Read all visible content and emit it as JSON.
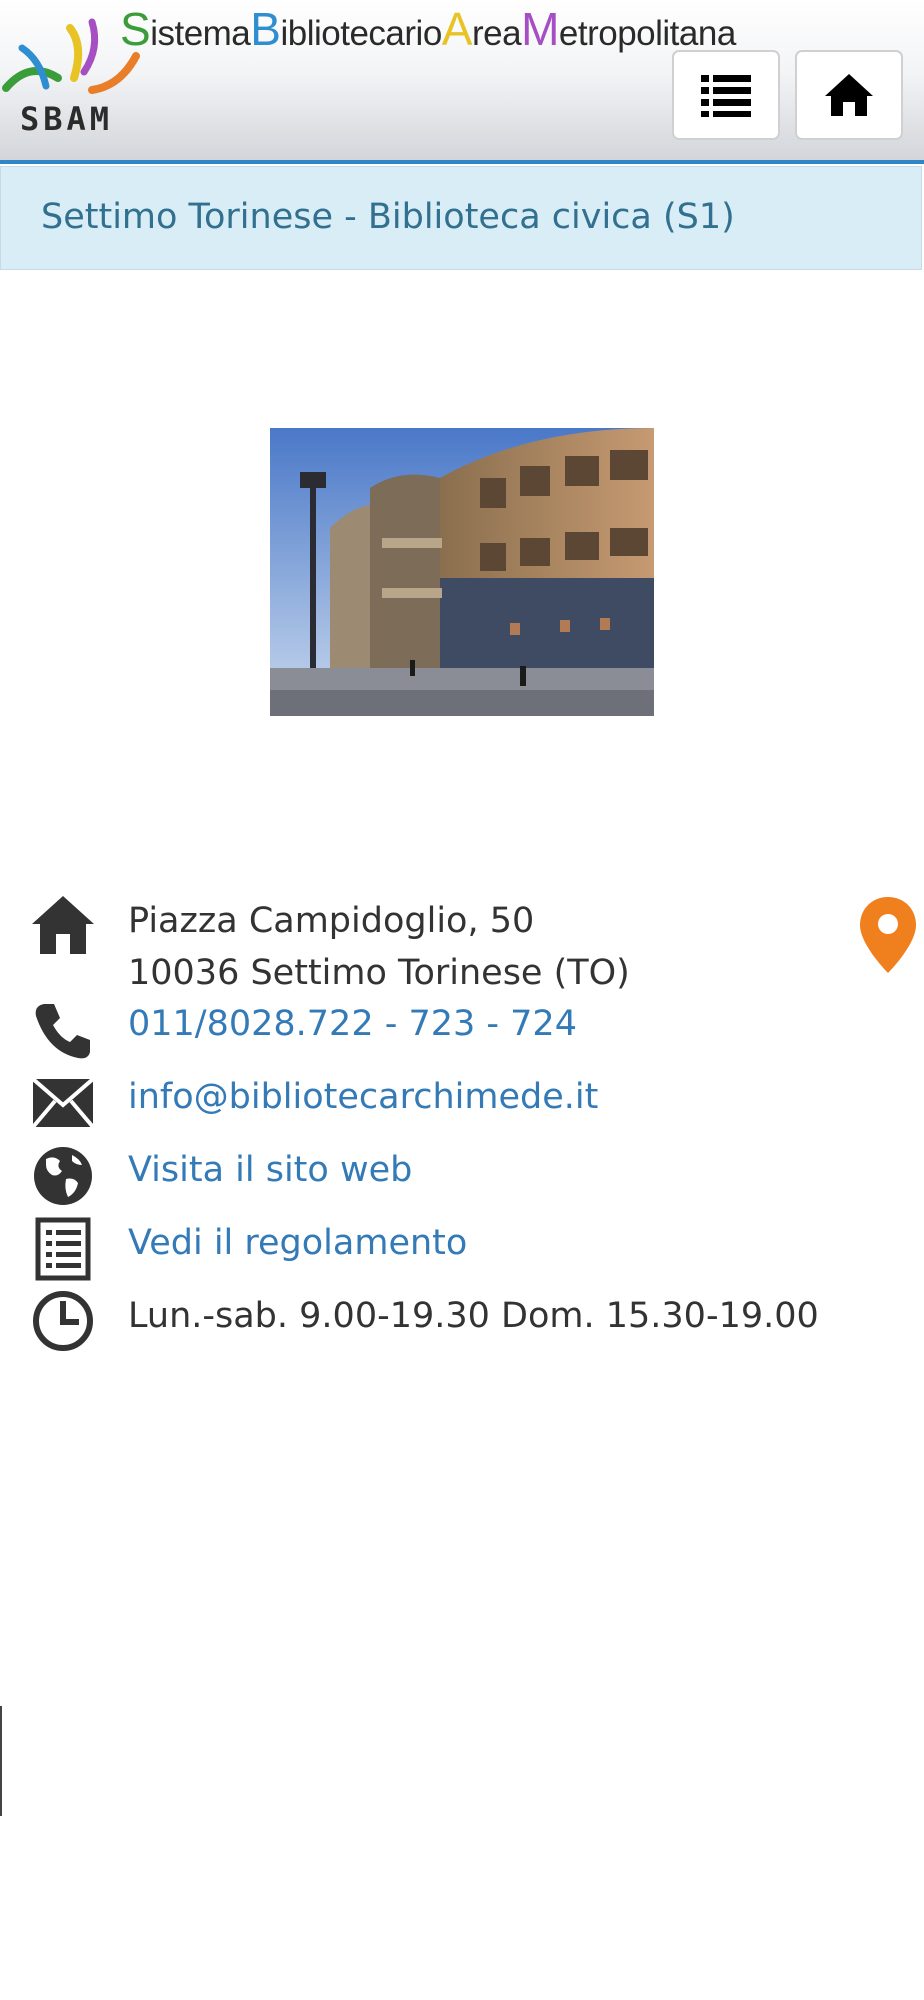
{
  "header": {
    "logo_text": "SBAM",
    "brand": [
      {
        "cap": "S",
        "rest": "istema",
        "color": "#3a9d3a"
      },
      {
        "cap": "B",
        "rest": "ibliotecario",
        "color": "#2f8ed0"
      },
      {
        "cap": "A",
        "rest": "rea",
        "color": "#e8c325"
      },
      {
        "cap": "M",
        "rest": "etropolitana",
        "color": "#a54fc2"
      }
    ],
    "list_button_icon": "list-icon",
    "home_button_icon": "home-icon"
  },
  "page": {
    "title": "Settimo Torinese - Biblioteca civica (S1)"
  },
  "info": {
    "address_line1": "Piazza Campidoglio, 50",
    "address_line2": "10036 Settimo Torinese (TO)",
    "phone": "011/8028.722 - 723 - 724",
    "email": "info@bibliotecarchimede.it",
    "website_label": "Visita il sito web",
    "rules_label": "Vedi il regolamento",
    "hours": "Lun.-sab. 9.00-19.30 Dom. 15.30-19.00"
  },
  "colors": {
    "accent_blue": "#2f86c7",
    "link_blue": "#337ab7",
    "title_bg": "#d9edf7",
    "title_text": "#31708f",
    "map_pin": "#f07f1e"
  }
}
